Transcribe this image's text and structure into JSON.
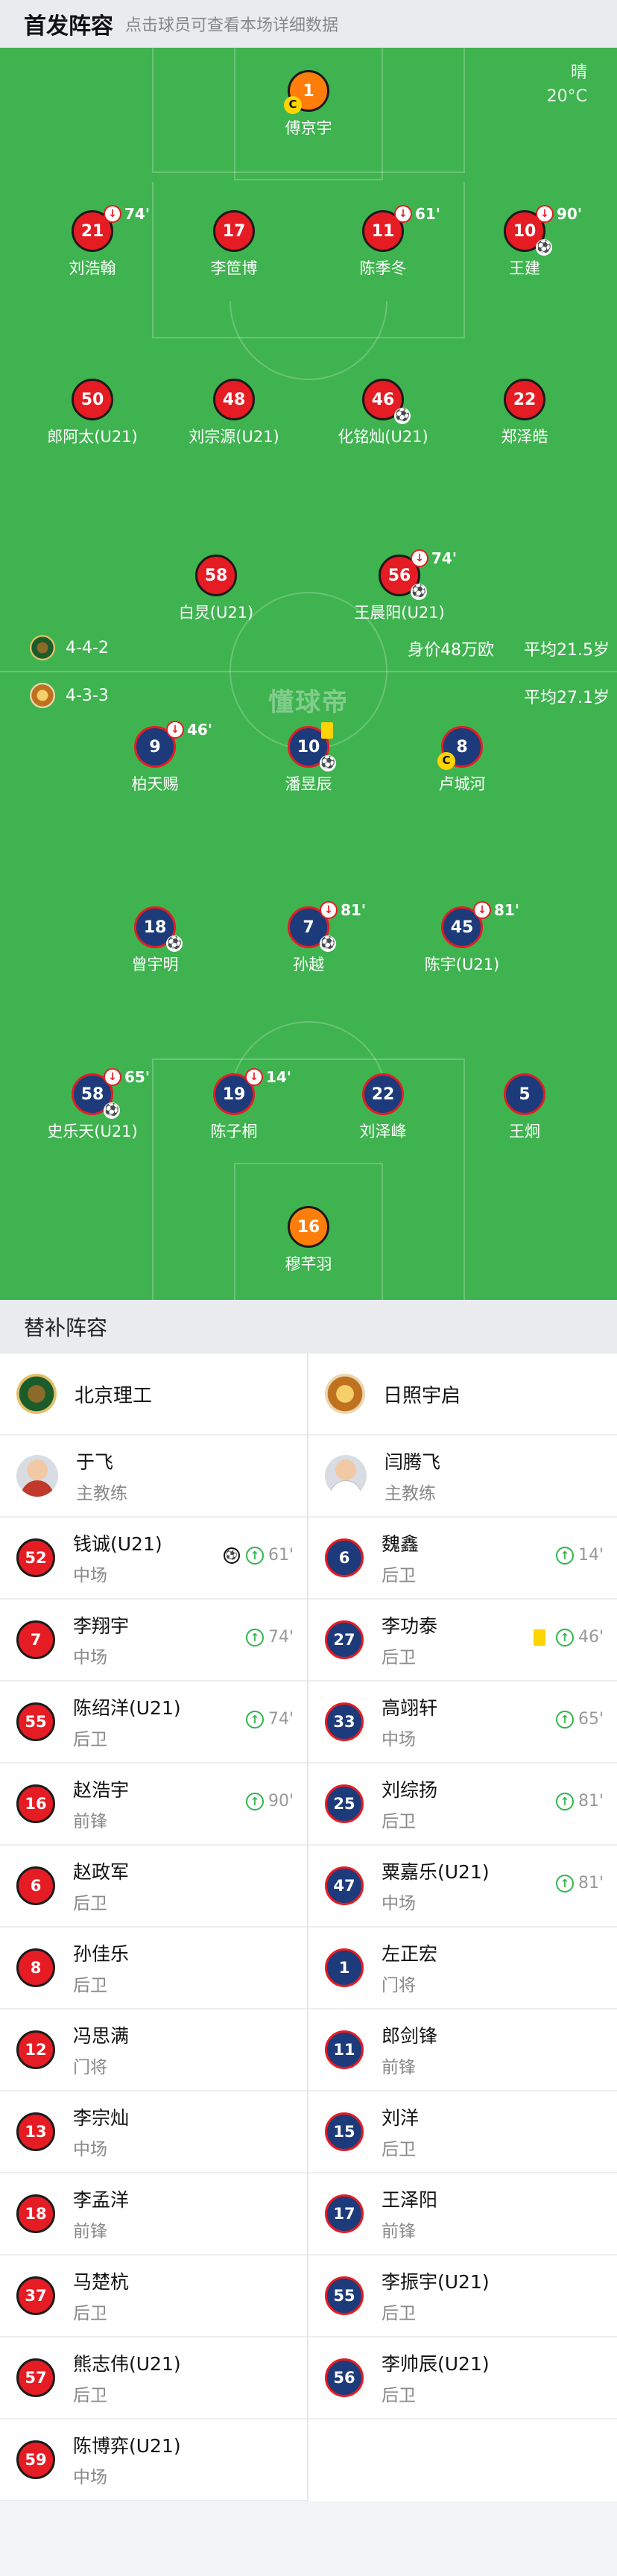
{
  "header": {
    "title": "首发阵容",
    "subtitle": "点击球员可查看本场详细数据"
  },
  "weather": {
    "condition": "晴",
    "temp": "20°C"
  },
  "watermark": "懂球帝",
  "home": {
    "formation": "4-4-2",
    "value": "身价48万欧",
    "age": "平均21.5岁",
    "color": "#e51c23"
  },
  "away": {
    "formation": "4-3-3",
    "age": "平均27.1岁",
    "color": "#1d3b7a"
  },
  "lineup_home": [
    {
      "num": "1",
      "name": "傅京宇",
      "kit": "orange",
      "captain": true
    },
    {
      "num": "21",
      "name": "刘浩翰",
      "sub": "74'"
    },
    {
      "num": "17",
      "name": "李笸博"
    },
    {
      "num": "11",
      "name": "陈季冬",
      "sub": "61'"
    },
    {
      "num": "10",
      "name": "王建",
      "sub": "90'",
      "ball": true
    },
    {
      "num": "50",
      "name": "郎阿太(U21)"
    },
    {
      "num": "48",
      "name": "刘宗源(U21)"
    },
    {
      "num": "46",
      "name": "化铭灿(U21)",
      "ball": true
    },
    {
      "num": "22",
      "name": "郑泽皓"
    },
    {
      "num": "58",
      "name": "白炅(U21)"
    },
    {
      "num": "56",
      "name": "王晨阳(U21)",
      "sub": "74'",
      "ball": true
    }
  ],
  "lineup_away": [
    {
      "num": "9",
      "name": "柏天赐",
      "sub": "46'"
    },
    {
      "num": "10",
      "name": "潘昱辰",
      "yellow": true,
      "ball": true
    },
    {
      "num": "8",
      "name": "卢城河",
      "captain": true
    },
    {
      "num": "18",
      "name": "曾宇明",
      "ball": true
    },
    {
      "num": "7",
      "name": "孙越",
      "sub": "81'",
      "ball": true
    },
    {
      "num": "45",
      "name": "陈宇(U21)",
      "sub": "81'"
    },
    {
      "num": "58",
      "name": "史乐天(U21)",
      "sub": "65'",
      "ball": true
    },
    {
      "num": "19",
      "name": "陈子桐",
      "sub": "14'"
    },
    {
      "num": "22",
      "name": "刘泽峰"
    },
    {
      "num": "5",
      "name": "王炯"
    },
    {
      "num": "16",
      "name": "穆芊羽",
      "kit": "orange"
    }
  ],
  "subs_header": "替补阵容",
  "teams": {
    "home_name": "北京理工",
    "away_name": "日照宇启"
  },
  "coaches": {
    "home": {
      "name": "于飞",
      "role": "主教练"
    },
    "away": {
      "name": "闫腾飞",
      "role": "主教练"
    }
  },
  "bench_home": [
    {
      "num": "52",
      "name": "钱诚(U21)",
      "pos": "中场",
      "min": "61'",
      "ball": true
    },
    {
      "num": "7",
      "name": "李翔宇",
      "pos": "中场",
      "min": "74'"
    },
    {
      "num": "55",
      "name": "陈绍洋(U21)",
      "pos": "后卫",
      "min": "74'"
    },
    {
      "num": "16",
      "name": "赵浩宇",
      "pos": "前锋",
      "min": "90'"
    },
    {
      "num": "6",
      "name": "赵政军",
      "pos": "后卫"
    },
    {
      "num": "8",
      "name": "孙佳乐",
      "pos": "后卫"
    },
    {
      "num": "12",
      "name": "冯思满",
      "pos": "门将"
    },
    {
      "num": "13",
      "name": "李宗灿",
      "pos": "中场"
    },
    {
      "num": "18",
      "name": "李孟洋",
      "pos": "前锋"
    },
    {
      "num": "37",
      "name": "马楚杭",
      "pos": "后卫"
    },
    {
      "num": "57",
      "name": "熊志伟(U21)",
      "pos": "后卫"
    },
    {
      "num": "59",
      "name": "陈博弈(U21)",
      "pos": "中场"
    }
  ],
  "bench_away": [
    {
      "num": "6",
      "name": "魏鑫",
      "pos": "后卫",
      "min": "14'"
    },
    {
      "num": "27",
      "name": "李功泰",
      "pos": "后卫",
      "min": "46'",
      "yellow": true
    },
    {
      "num": "33",
      "name": "高翊轩",
      "pos": "中场",
      "min": "65'"
    },
    {
      "num": "25",
      "name": "刘综扬",
      "pos": "后卫",
      "min": "81'"
    },
    {
      "num": "47",
      "name": "粟嘉乐(U21)",
      "pos": "中场",
      "min": "81'"
    },
    {
      "num": "1",
      "name": "左正宏",
      "pos": "门将"
    },
    {
      "num": "11",
      "name": "郎剑锋",
      "pos": "前锋"
    },
    {
      "num": "15",
      "name": "刘洋",
      "pos": "后卫"
    },
    {
      "num": "17",
      "name": "王泽阳",
      "pos": "前锋"
    },
    {
      "num": "55",
      "name": "李振宇(U21)",
      "pos": "后卫"
    },
    {
      "num": "56",
      "name": "李帅辰(U21)",
      "pos": "后卫"
    }
  ]
}
